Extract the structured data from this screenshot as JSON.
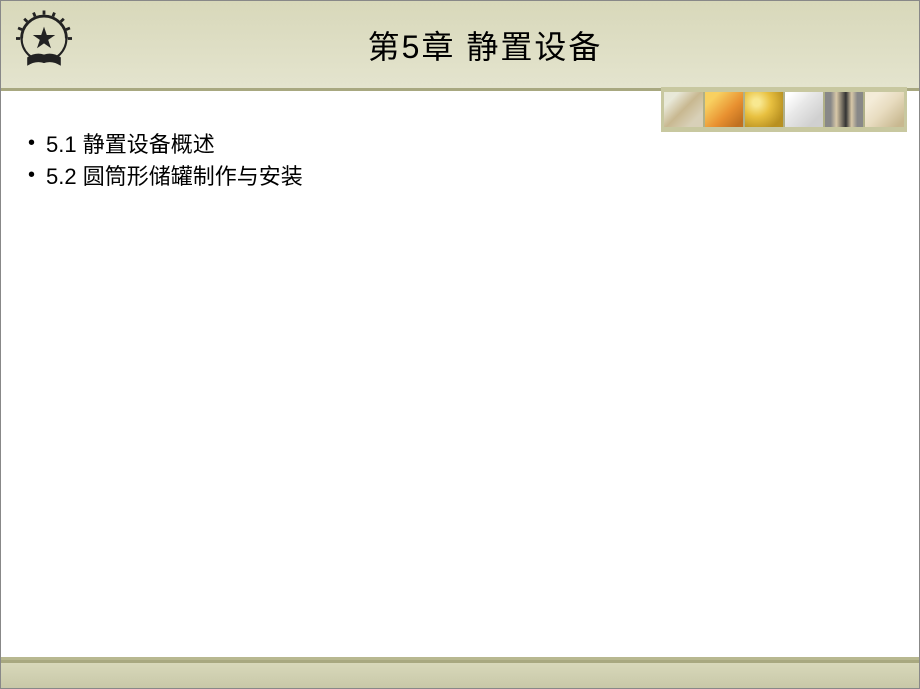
{
  "slide": {
    "title": "第5章   静置设备",
    "bullets": [
      {
        "text": "5.1 静置设备概述"
      },
      {
        "text": "5.2 圆筒形储罐制作与安装"
      }
    ],
    "logo_alt": "star-book-emblem"
  }
}
